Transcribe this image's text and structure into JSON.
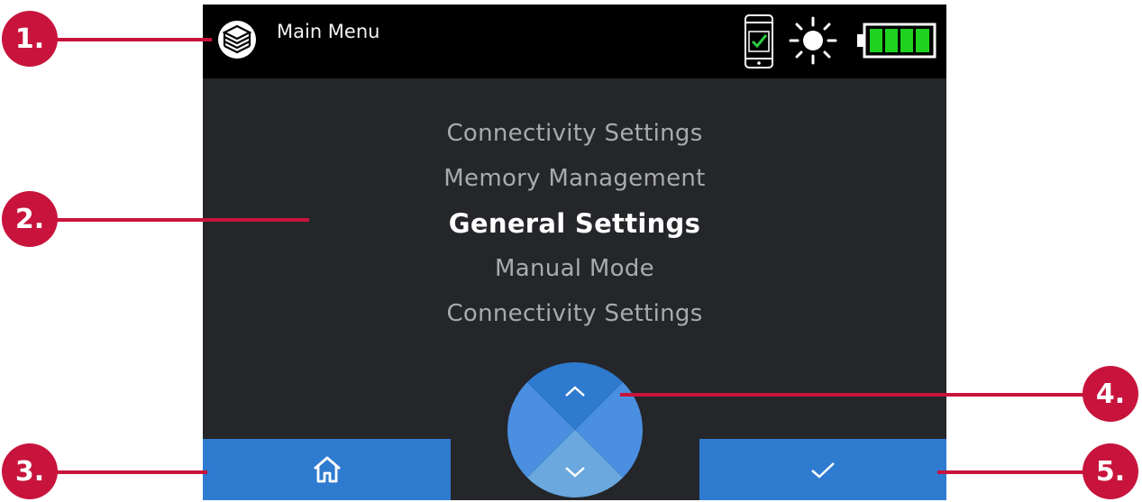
{
  "header": {
    "title": "Main Menu",
    "icons": [
      "app-logo-icon",
      "phone-connected-icon",
      "brightness-icon",
      "battery-full-icon"
    ]
  },
  "menu": {
    "items": [
      {
        "label": "Connectivity Settings",
        "selected": false
      },
      {
        "label": "Memory Management",
        "selected": false
      },
      {
        "label": "General Settings",
        "selected": true
      },
      {
        "label": "Manual Mode",
        "selected": false
      },
      {
        "label": "Connectivity Settings",
        "selected": false
      }
    ]
  },
  "controls": {
    "home_icon": "home-icon",
    "up_icon": "chevron-up-icon",
    "down_icon": "chevron-down-icon",
    "confirm_icon": "check-icon"
  },
  "callouts": [
    "1.",
    "2.",
    "3.",
    "4.",
    "5."
  ],
  "colors": {
    "screen_bg": "#24262a",
    "topbar_bg": "#000000",
    "button_blue": "#2f7bd0",
    "callout_red": "#c8143c",
    "battery_green": "#1fd21f",
    "check_green": "#2ecc40"
  }
}
